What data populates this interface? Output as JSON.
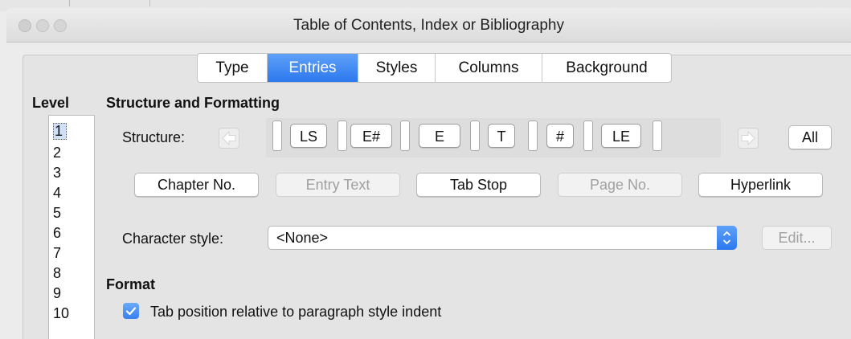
{
  "window": {
    "title": "Table of Contents, Index or Bibliography",
    "traffic_light_color": "#cfcfcf"
  },
  "tabs": [
    {
      "label": "Type",
      "active": false
    },
    {
      "label": "Entries",
      "active": true
    },
    {
      "label": "Styles",
      "active": false
    },
    {
      "label": "Columns",
      "active": false
    },
    {
      "label": "Background",
      "active": false
    }
  ],
  "accent_color": "#2c78ee",
  "level": {
    "heading": "Level",
    "items": [
      "1",
      "2",
      "3",
      "4",
      "5",
      "6",
      "7",
      "8",
      "9",
      "10"
    ],
    "selected": "1"
  },
  "structure_section": {
    "heading": "Structure and Formatting",
    "structure_label": "Structure:",
    "tokens": [
      "LS",
      "E#",
      "E",
      "T",
      "#",
      "LE"
    ],
    "all_button": "All",
    "left_arrow_icon": "arrow-left-icon",
    "right_arrow_icon": "arrow-right-icon"
  },
  "insert_buttons": [
    {
      "label": "Chapter No.",
      "enabled": true
    },
    {
      "label": "Entry Text",
      "enabled": false
    },
    {
      "label": "Tab Stop",
      "enabled": true
    },
    {
      "label": "Page No.",
      "enabled": false
    },
    {
      "label": "Hyperlink",
      "enabled": true
    }
  ],
  "character_style": {
    "label": "Character style:",
    "value": "<None>",
    "edit_button": "Edit..."
  },
  "format": {
    "heading": "Format",
    "tab_relative_label": "Tab position relative to paragraph style indent",
    "tab_relative_checked": true
  }
}
